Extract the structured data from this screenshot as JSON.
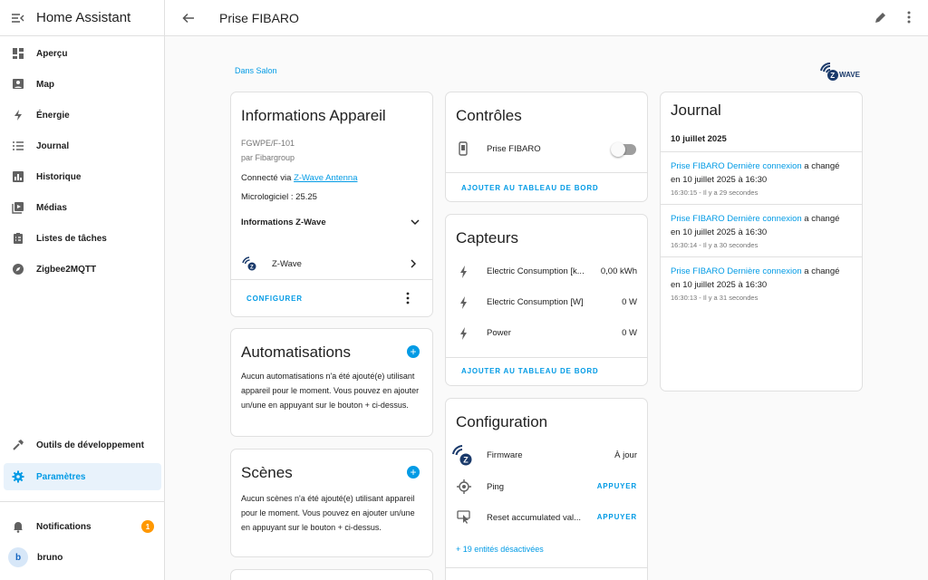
{
  "sidebar": {
    "title": "Home Assistant",
    "items": [
      {
        "label": "Aperçu",
        "icon": "dashboard-icon"
      },
      {
        "label": "Map",
        "icon": "map-icon"
      },
      {
        "label": "Énergie",
        "icon": "lightning-icon"
      },
      {
        "label": "Journal",
        "icon": "list-icon"
      },
      {
        "label": "Historique",
        "icon": "chart-bar-icon"
      },
      {
        "label": "Médias",
        "icon": "media-icon"
      },
      {
        "label": "Listes de tâches",
        "icon": "clipboard-list-icon"
      },
      {
        "label": "Zigbee2MQTT",
        "icon": "compass-icon"
      }
    ],
    "dev_tools": "Outils de développement",
    "settings": "Paramètres",
    "notifications": "Notifications",
    "notification_count": "1",
    "user_initial": "b",
    "user_name": "bruno"
  },
  "header": {
    "title": "Prise FIBARO"
  },
  "area_link": "Dans Salon",
  "zwave_logo_text": "WAVE",
  "device_info": {
    "title": "Informations Appareil",
    "model": "FGWPE/F-101",
    "manufacturer": "par Fibargroup",
    "connected_prefix": "Connecté via ",
    "connected_link": "Z-Wave Antenna",
    "firmware": "Micrologiciel : 25.25",
    "zwave_info": "Informations Z-Wave",
    "integration": "Z-Wave",
    "configure": "CONFIGURER"
  },
  "automations": {
    "title": "Automatisations",
    "text": "Aucun automatisations n'a été ajouté(e) utilisant appareil pour le moment. Vous pouvez en ajouter un/une en appuyant sur le bouton + ci-dessus."
  },
  "scenes": {
    "title": "Scènes",
    "text": "Aucun scènes n'a été ajouté(e) utilisant appareil pour le moment. Vous pouvez en ajouter un/une en appuyant sur le bouton + ci-dessus."
  },
  "controls": {
    "title": "Contrôles",
    "switch_label": "Prise FIBARO",
    "add_dashboard": "AJOUTER AU TABLEAU DE BORD"
  },
  "sensors": {
    "title": "Capteurs",
    "rows": [
      {
        "name": "Electric Consumption [k...",
        "value": "0,00 kWh"
      },
      {
        "name": "Electric Consumption [W]",
        "value": "0 W"
      },
      {
        "name": "Power",
        "value": "0 W"
      }
    ],
    "add_dashboard": "AJOUTER AU TABLEAU DE BORD"
  },
  "configuration": {
    "title": "Configuration",
    "firmware_label": "Firmware",
    "firmware_value": "À jour",
    "ping_label": "Ping",
    "ping_button": "APPUYER",
    "reset_label": "Reset accumulated val...",
    "reset_button": "APPUYER",
    "disabled_entities": "+ 19 entités désactivées"
  },
  "journal": {
    "title": "Journal",
    "date": "10 juillet 2025",
    "entries": [
      {
        "entity": "Prise FIBARO Dernière connexion",
        "action": " a changé",
        "detail": "en 10 juillet 2025 à 16:30",
        "time": "16:30:15 - Il y a 29 secondes"
      },
      {
        "entity": "Prise FIBARO Dernière connexion",
        "action": " a changé",
        "detail": "en 10 juillet 2025 à 16:30",
        "time": "16:30:14 - Il y a 30 secondes"
      },
      {
        "entity": "Prise FIBARO Dernière connexion",
        "action": " a changé",
        "detail": "en 10 juillet 2025 à 16:30",
        "time": "16:30:13 - Il y a 31 secondes"
      }
    ]
  },
  "colors": {
    "accent": "#039be5",
    "badge": "#ff9800",
    "zwave": "#1a3a6b"
  }
}
